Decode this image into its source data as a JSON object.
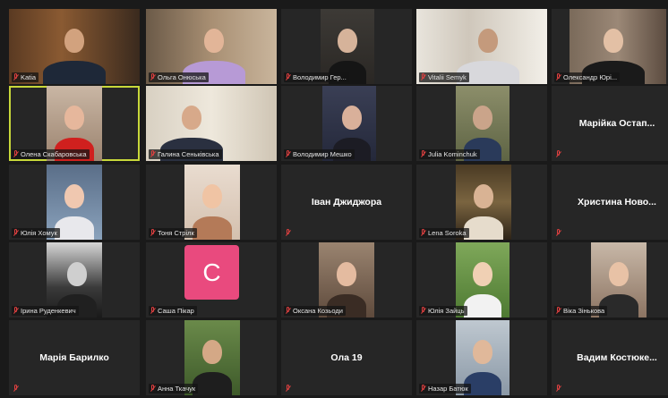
{
  "colors": {
    "background": "#1a1a1a",
    "tile": "#262626",
    "active_speaker_border": "#c8d83a",
    "muted_icon": "#e04040",
    "avatar_c": "#e94a7e"
  },
  "participants": [
    {
      "name": "Katia",
      "video": true,
      "muted": true
    },
    {
      "name": "Ольга Онюська",
      "video": true,
      "muted": true
    },
    {
      "name": "Володимир Гер...",
      "video": true,
      "muted": true
    },
    {
      "name": "Vitalii Semyk",
      "video": true,
      "muted": true
    },
    {
      "name": "Олександр Юрі...",
      "video": true,
      "muted": true
    },
    {
      "name": "Олена Скабаровська",
      "video": true,
      "muted": true,
      "active": true
    },
    {
      "name": "Галина Сеньківська",
      "video": true,
      "muted": true
    },
    {
      "name": "Володимир Мешко",
      "video": true,
      "muted": true
    },
    {
      "name": "Julia Kominchuk",
      "video": true,
      "muted": true
    },
    {
      "name": "Марійка Остап...",
      "video": false,
      "muted": true
    },
    {
      "name": "Юлія Хомук",
      "video": true,
      "muted": true
    },
    {
      "name": "Тоня Стрілк",
      "video": true,
      "muted": true
    },
    {
      "name": "Іван Джиджора",
      "video": false,
      "muted": true
    },
    {
      "name": "Lena Soroka",
      "video": true,
      "muted": true
    },
    {
      "name": "Христина Ново...",
      "video": false,
      "muted": true
    },
    {
      "name": "Ірина Руденкевич",
      "video": true,
      "muted": true
    },
    {
      "name": "Саша Пікар",
      "video": false,
      "avatar_letter": "C",
      "muted": true
    },
    {
      "name": "Оксана Козьоди",
      "video": true,
      "muted": true
    },
    {
      "name": "Юлія Зайць",
      "video": true,
      "muted": true
    },
    {
      "name": "Віка Зінькова",
      "video": true,
      "muted": true
    },
    {
      "name": "Марія Барилко",
      "video": false,
      "muted": true
    },
    {
      "name": "Анна Ткачук",
      "video": true,
      "muted": true
    },
    {
      "name": "Ола 19",
      "video": false,
      "muted": true
    },
    {
      "name": "Назар Батюк",
      "video": true,
      "muted": true
    },
    {
      "name": "Вадим Костюке...",
      "video": false,
      "muted": true
    }
  ]
}
